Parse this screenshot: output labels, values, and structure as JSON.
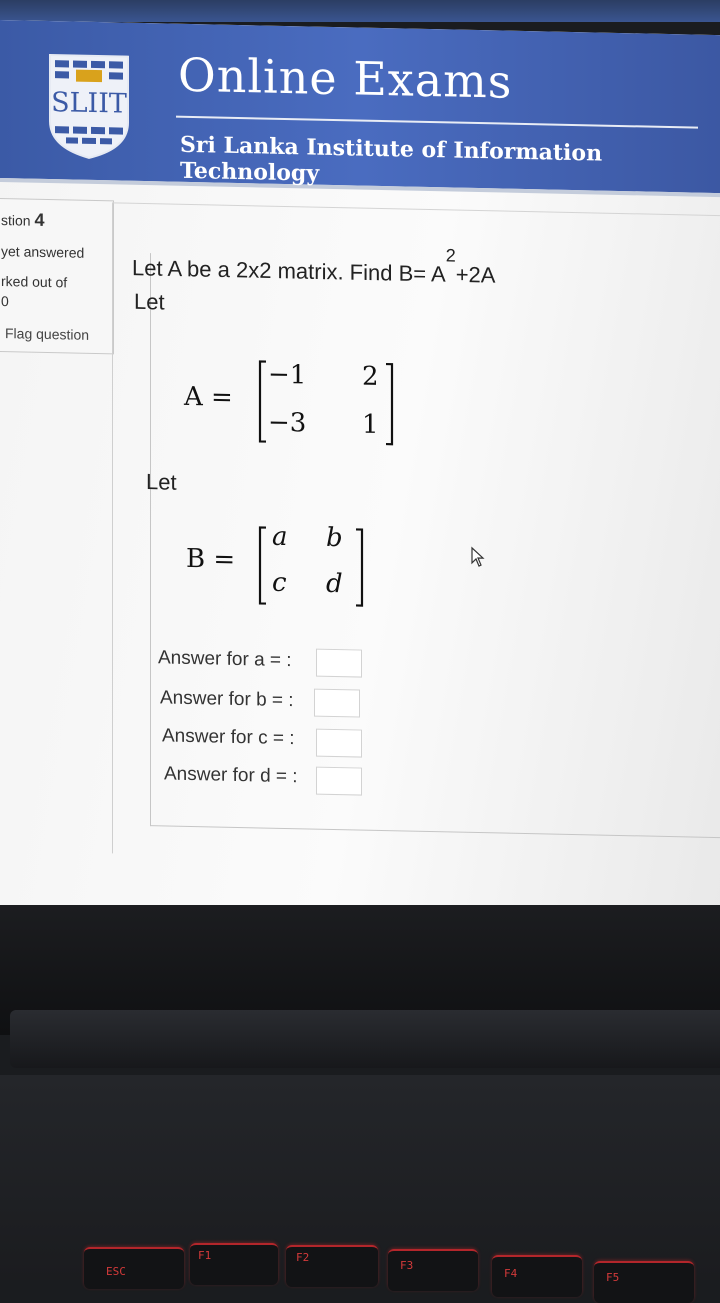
{
  "banner": {
    "logo_text": "SLIIT",
    "title": "Online Exams",
    "subtitle": "Sri Lanka Institute of Information Technology"
  },
  "question_info": {
    "number_label": "stion",
    "number": "4",
    "status": "yet answered",
    "marked": "rked out of",
    "marked_value": "0",
    "flag_label": "Flag question"
  },
  "question": {
    "text_prefix": "Let A be a 2x2 matrix. Find B= A",
    "exponent": "2",
    "text_suffix": "+2A",
    "let1": "Let",
    "matrix_a_label": "A =",
    "matrix_a": [
      [
        "−1",
        "2"
      ],
      [
        "−3",
        "1"
      ]
    ],
    "let2": "Let",
    "matrix_b_label": "B =",
    "matrix_b": [
      [
        "a",
        "b"
      ],
      [
        "c",
        "d"
      ]
    ]
  },
  "answers": [
    {
      "label": "Answer for a = :",
      "value": ""
    },
    {
      "label": "Answer for b = :",
      "value": ""
    },
    {
      "label": "Answer for c = :",
      "value": ""
    },
    {
      "label": "Answer for d = :",
      "value": ""
    }
  ],
  "keyboard": {
    "keys": [
      "ESC",
      "F1",
      "F2",
      "F3",
      "F4",
      "F5"
    ]
  },
  "colors": {
    "banner": "#4466b8",
    "key_accent": "#d43a3a"
  }
}
